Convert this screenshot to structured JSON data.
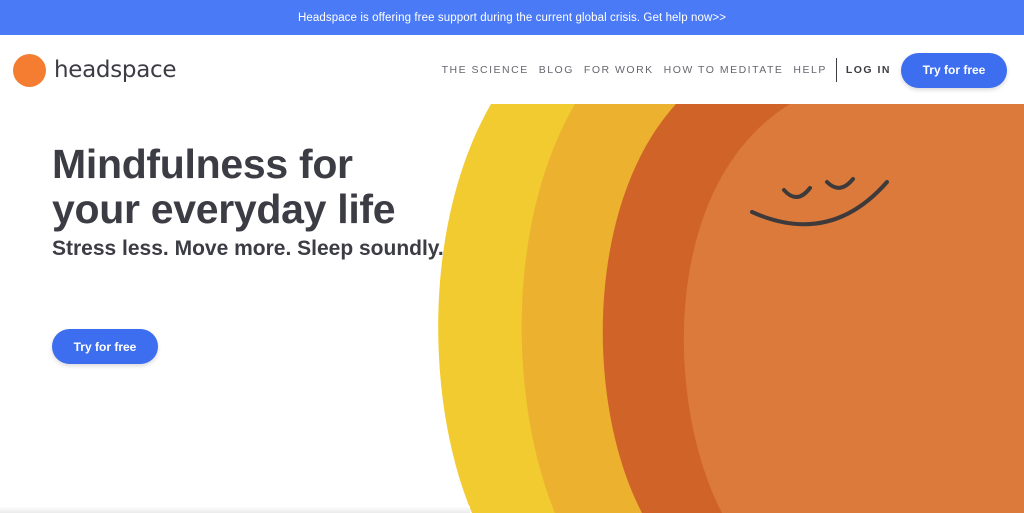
{
  "banner": {
    "text": "Headspace is offering free support during the current global crisis. Get help now>>"
  },
  "header": {
    "logo_text": "headspace",
    "nav": [
      {
        "label": "THE SCIENCE"
      },
      {
        "label": "BLOG"
      },
      {
        "label": "FOR WORK"
      },
      {
        "label": "HOW TO MEDITATE"
      },
      {
        "label": "HELP"
      }
    ],
    "login_label": "LOG IN",
    "cta_label": "Try for free"
  },
  "hero": {
    "title_line1": "Mindfulness for",
    "title_line2": "your everyday life",
    "subtitle": "Stress less. Move more. Sleep soundly.",
    "cta_label": "Try for free",
    "illustration_icon": "sleeping-smiley-face-icon"
  },
  "colors": {
    "banner_bg": "#4a7af5",
    "button_blue": "#3d6ef0",
    "logo_orange": "#f47d31",
    "arc_yellow": "#f1cb30",
    "arc_gold": "#ebb12f",
    "arc_orange": "#d06327",
    "sun_orange": "#db7a3a",
    "text_dark": "#3c3c44"
  }
}
